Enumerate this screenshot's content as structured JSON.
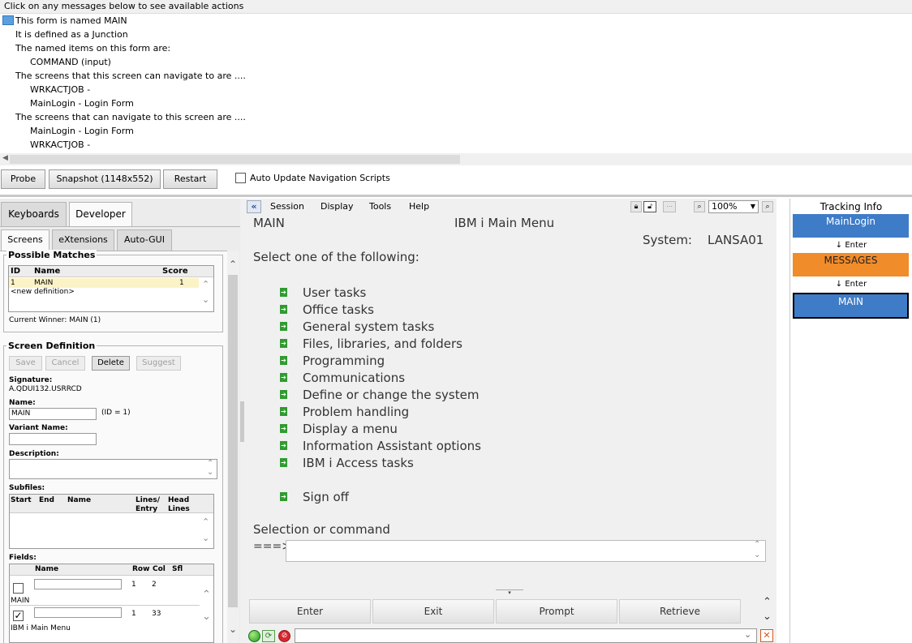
{
  "messages": {
    "header": "Click on any messages below to see available actions",
    "lines": [
      "This form is named MAIN",
      "It is defined as a Junction",
      "The named items on this form are:",
      "COMMAND (input)",
      "The screens that this screen can navigate to are ....",
      "WRKACTJOB  -",
      "MainLogin  - Login Form",
      "The screens that can navigate to this screen are ....",
      "MainLogin  - Login Form",
      "WRKACTJOB  -"
    ]
  },
  "toolbar": {
    "probe": "Probe",
    "snapshot": "Snapshot (1148x552)",
    "restart": "Restart",
    "auto_update": "Auto Update Navigation Scripts"
  },
  "left": {
    "tabs": [
      "Keyboards",
      "Developer"
    ],
    "subtabs": [
      "Screens",
      "eXtensions",
      "Auto-GUI"
    ],
    "possible_matches": {
      "title": "Possible Matches",
      "headers": [
        "ID",
        "Name",
        "Score"
      ],
      "row": {
        "id": "1",
        "name": "MAIN",
        "score": "1"
      },
      "new_def": "<new definition>",
      "winner": "Current Winner: MAIN (1)"
    },
    "screen_def": {
      "title": "Screen Definition",
      "buttons": [
        "Save",
        "Cancel",
        "Delete",
        "Suggest"
      ],
      "signature_label": "Signature:",
      "signature_value": "A.QDUI132.USRRCD",
      "name_label": "Name:",
      "name_value": "MAIN",
      "id_text": "(ID = 1)",
      "variant_label": "Variant Name:",
      "description_label": "Description:",
      "subfiles_label": "Subfiles:",
      "subfile_headers": [
        "Start",
        "End",
        "Name",
        "Lines/ Entry",
        "Head Lines"
      ],
      "fields_label": "Fields:",
      "field_headers": [
        "Name",
        "Row",
        "Col",
        "Sfl"
      ],
      "fields": [
        {
          "row": "1",
          "col": "2",
          "caption": "MAIN",
          "checked": false
        },
        {
          "row": "1",
          "col": "33",
          "caption": "IBM i Main Menu",
          "checked": true
        }
      ]
    }
  },
  "center": {
    "menu": [
      "Session",
      "Display",
      "Tools",
      "Help"
    ],
    "zoom": "100%",
    "screen": {
      "name": "MAIN",
      "title": "IBM i Main Menu",
      "system_label": "System:",
      "system_value": "LANSA01",
      "prompt": "Select one of the following:",
      "options": [
        "User tasks",
        "Office tasks",
        "General system tasks",
        "Files, libraries, and folders",
        "Programming",
        "Communications",
        "Define or change the system",
        "Problem handling",
        "Display a menu",
        "Information Assistant options",
        "IBM i Access tasks"
      ],
      "signoff": "Sign off",
      "selection_label": "Selection or command",
      "command_prefix": "===>"
    },
    "fkeys": [
      "Enter",
      "Exit",
      "Prompt",
      "Retrieve"
    ]
  },
  "right": {
    "title": "Tracking Info",
    "items": [
      {
        "label": "MainLogin",
        "color": "#3f7cc7"
      },
      {
        "label": "MESSAGES",
        "color": "#f08c2a"
      },
      {
        "label": "MAIN",
        "color": "#3f7cc7"
      }
    ],
    "enter": "↓ Enter"
  }
}
